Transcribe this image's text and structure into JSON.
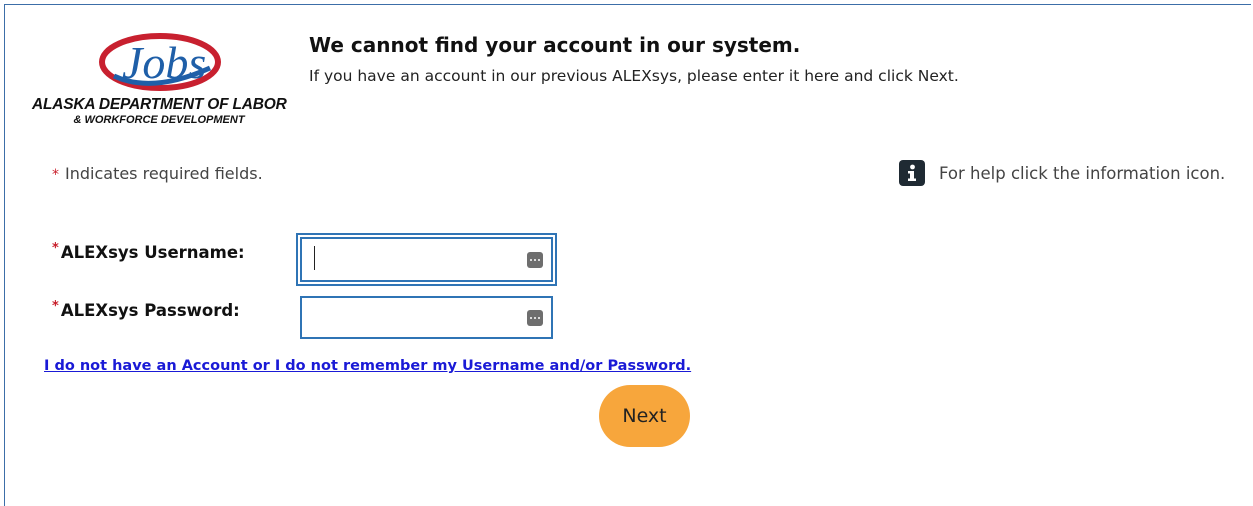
{
  "logo": {
    "wordmark": "Jobs",
    "line1": "ALASKA DEPARTMENT OF LABOR",
    "line2": "& WORKFORCE DEVELOPMENT"
  },
  "header": {
    "title": "We cannot find your account in our system.",
    "subtitle": "If you have an account in our previous ALEXsys, please enter it here and click Next."
  },
  "required_note": {
    "marker": "*",
    "text": "Indicates required fields."
  },
  "help": {
    "icon": "info-icon",
    "text": "For help click the information icon."
  },
  "form": {
    "username": {
      "required_marker": "*",
      "label": "ALEXsys Username:",
      "value": "",
      "focused": true
    },
    "password": {
      "required_marker": "*",
      "label": "ALEXsys Password:",
      "value": ""
    }
  },
  "link_text": "I do not have an Account or I do not remember my Username and/or Password.",
  "next_label": "Next",
  "colors": {
    "accent_blue": "#2f74b5",
    "required_red": "#c81e2a",
    "button_orange": "#f7a63c",
    "link_blue": "#1a1ad6"
  }
}
